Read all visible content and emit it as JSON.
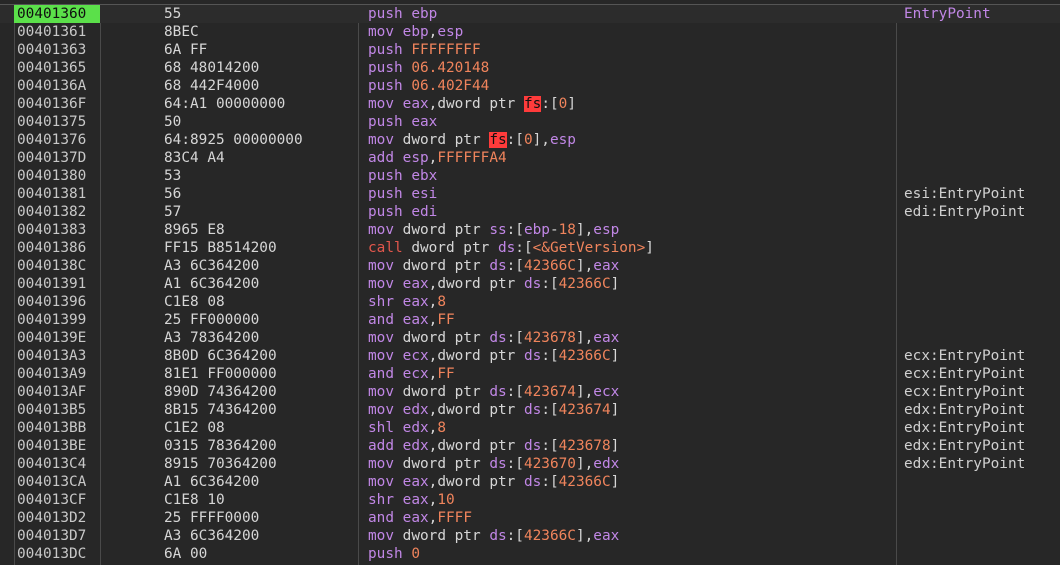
{
  "rows": [
    {
      "addr": "00401360",
      "bytes": "55",
      "selected": true,
      "comment": "EntryPoint",
      "comment_style": "entry",
      "instr": [
        [
          "mn",
          "push"
        ],
        [
          "txt",
          " "
        ],
        [
          "reg",
          "ebp"
        ]
      ]
    },
    {
      "addr": "00401361",
      "bytes": "8BEC",
      "comment": "",
      "instr": [
        [
          "mn",
          "mov"
        ],
        [
          "txt",
          " "
        ],
        [
          "reg",
          "ebp"
        ],
        [
          "txt",
          ","
        ],
        [
          "reg",
          "esp"
        ]
      ]
    },
    {
      "addr": "00401363",
      "bytes": "6A FF",
      "comment": "",
      "instr": [
        [
          "mn",
          "push"
        ],
        [
          "txt",
          " "
        ],
        [
          "num",
          "FFFFFFFF"
        ]
      ]
    },
    {
      "addr": "00401365",
      "bytes": "68 48014200",
      "comment": "",
      "instr": [
        [
          "mn",
          "push"
        ],
        [
          "txt",
          " "
        ],
        [
          "num",
          "06.420148"
        ]
      ]
    },
    {
      "addr": "0040136A",
      "bytes": "68 442F4000",
      "comment": "",
      "instr": [
        [
          "mn",
          "push"
        ],
        [
          "txt",
          " "
        ],
        [
          "num",
          "06.402F44"
        ]
      ]
    },
    {
      "addr": "0040136F",
      "bytes": "64:A1 00000000",
      "comment": "",
      "instr": [
        [
          "mn",
          "mov"
        ],
        [
          "txt",
          " "
        ],
        [
          "reg",
          "eax"
        ],
        [
          "txt",
          ",dword ptr "
        ],
        [
          "hl",
          "fs"
        ],
        [
          "txt",
          ":["
        ],
        [
          "num",
          "0"
        ],
        [
          "txt",
          "]"
        ]
      ]
    },
    {
      "addr": "00401375",
      "bytes": "50",
      "comment": "",
      "instr": [
        [
          "mn",
          "push"
        ],
        [
          "txt",
          " "
        ],
        [
          "reg",
          "eax"
        ]
      ]
    },
    {
      "addr": "00401376",
      "bytes": "64:8925 00000000",
      "comment": "",
      "instr": [
        [
          "mn",
          "mov"
        ],
        [
          "txt",
          " dword ptr "
        ],
        [
          "hl",
          "fs"
        ],
        [
          "txt",
          ":["
        ],
        [
          "num",
          "0"
        ],
        [
          "txt",
          "],"
        ],
        [
          "reg",
          "esp"
        ]
      ]
    },
    {
      "addr": "0040137D",
      "bytes": "83C4 A4",
      "comment": "",
      "instr": [
        [
          "mn",
          "add"
        ],
        [
          "txt",
          " "
        ],
        [
          "reg",
          "esp"
        ],
        [
          "txt",
          ","
        ],
        [
          "num",
          "FFFFFFA4"
        ]
      ]
    },
    {
      "addr": "00401380",
      "bytes": "53",
      "comment": "",
      "instr": [
        [
          "mn",
          "push"
        ],
        [
          "txt",
          " "
        ],
        [
          "reg",
          "ebx"
        ]
      ]
    },
    {
      "addr": "00401381",
      "bytes": "56",
      "comment": "esi:EntryPoint",
      "instr": [
        [
          "mn",
          "push"
        ],
        [
          "txt",
          " "
        ],
        [
          "reg",
          "esi"
        ]
      ]
    },
    {
      "addr": "00401382",
      "bytes": "57",
      "comment": "edi:EntryPoint",
      "instr": [
        [
          "mn",
          "push"
        ],
        [
          "txt",
          " "
        ],
        [
          "reg",
          "edi"
        ]
      ]
    },
    {
      "addr": "00401383",
      "bytes": "8965 E8",
      "comment": "",
      "instr": [
        [
          "mn",
          "mov"
        ],
        [
          "txt",
          " dword ptr "
        ],
        [
          "seg",
          "ss"
        ],
        [
          "txt",
          ":["
        ],
        [
          "reg",
          "ebp"
        ],
        [
          "txt",
          "-"
        ],
        [
          "num",
          "18"
        ],
        [
          "txt",
          "],"
        ],
        [
          "reg",
          "esp"
        ]
      ]
    },
    {
      "addr": "00401386",
      "bytes": "FF15 B8514200",
      "comment": "",
      "instr": [
        [
          "call",
          "call"
        ],
        [
          "txt",
          " dword ptr "
        ],
        [
          "seg",
          "ds"
        ],
        [
          "txt",
          ":["
        ],
        [
          "sym",
          "<&GetVersion>"
        ],
        [
          "txt",
          "]"
        ]
      ]
    },
    {
      "addr": "0040138C",
      "bytes": "A3 6C364200",
      "comment": "",
      "instr": [
        [
          "mn",
          "mov"
        ],
        [
          "txt",
          " dword ptr "
        ],
        [
          "seg",
          "ds"
        ],
        [
          "txt",
          ":["
        ],
        [
          "num",
          "42366C"
        ],
        [
          "txt",
          "],"
        ],
        [
          "reg",
          "eax"
        ]
      ]
    },
    {
      "addr": "00401391",
      "bytes": "A1 6C364200",
      "comment": "",
      "instr": [
        [
          "mn",
          "mov"
        ],
        [
          "txt",
          " "
        ],
        [
          "reg",
          "eax"
        ],
        [
          "txt",
          ",dword ptr "
        ],
        [
          "seg",
          "ds"
        ],
        [
          "txt",
          ":["
        ],
        [
          "num",
          "42366C"
        ],
        [
          "txt",
          "]"
        ]
      ]
    },
    {
      "addr": "00401396",
      "bytes": "C1E8 08",
      "comment": "",
      "instr": [
        [
          "mn",
          "shr"
        ],
        [
          "txt",
          " "
        ],
        [
          "reg",
          "eax"
        ],
        [
          "txt",
          ","
        ],
        [
          "num",
          "8"
        ]
      ]
    },
    {
      "addr": "00401399",
      "bytes": "25 FF000000",
      "comment": "",
      "instr": [
        [
          "mn",
          "and"
        ],
        [
          "txt",
          " "
        ],
        [
          "reg",
          "eax"
        ],
        [
          "txt",
          ","
        ],
        [
          "num",
          "FF"
        ]
      ]
    },
    {
      "addr": "0040139E",
      "bytes": "A3 78364200",
      "comment": "",
      "instr": [
        [
          "mn",
          "mov"
        ],
        [
          "txt",
          " dword ptr "
        ],
        [
          "seg",
          "ds"
        ],
        [
          "txt",
          ":["
        ],
        [
          "num",
          "423678"
        ],
        [
          "txt",
          "],"
        ],
        [
          "reg",
          "eax"
        ]
      ]
    },
    {
      "addr": "004013A3",
      "bytes": "8B0D 6C364200",
      "comment": "ecx:EntryPoint",
      "instr": [
        [
          "mn",
          "mov"
        ],
        [
          "txt",
          " "
        ],
        [
          "reg",
          "ecx"
        ],
        [
          "txt",
          ",dword ptr "
        ],
        [
          "seg",
          "ds"
        ],
        [
          "txt",
          ":["
        ],
        [
          "num",
          "42366C"
        ],
        [
          "txt",
          "]"
        ]
      ]
    },
    {
      "addr": "004013A9",
      "bytes": "81E1 FF000000",
      "comment": "ecx:EntryPoint",
      "instr": [
        [
          "mn",
          "and"
        ],
        [
          "txt",
          " "
        ],
        [
          "reg",
          "ecx"
        ],
        [
          "txt",
          ","
        ],
        [
          "num",
          "FF"
        ]
      ]
    },
    {
      "addr": "004013AF",
      "bytes": "890D 74364200",
      "comment": "ecx:EntryPoint",
      "instr": [
        [
          "mn",
          "mov"
        ],
        [
          "txt",
          " dword ptr "
        ],
        [
          "seg",
          "ds"
        ],
        [
          "txt",
          ":["
        ],
        [
          "num",
          "423674"
        ],
        [
          "txt",
          "],"
        ],
        [
          "reg",
          "ecx"
        ]
      ]
    },
    {
      "addr": "004013B5",
      "bytes": "8B15 74364200",
      "comment": "edx:EntryPoint",
      "instr": [
        [
          "mn",
          "mov"
        ],
        [
          "txt",
          " "
        ],
        [
          "reg",
          "edx"
        ],
        [
          "txt",
          ",dword ptr "
        ],
        [
          "seg",
          "ds"
        ],
        [
          "txt",
          ":["
        ],
        [
          "num",
          "423674"
        ],
        [
          "txt",
          "]"
        ]
      ]
    },
    {
      "addr": "004013BB",
      "bytes": "C1E2 08",
      "comment": "edx:EntryPoint",
      "instr": [
        [
          "mn",
          "shl"
        ],
        [
          "txt",
          " "
        ],
        [
          "reg",
          "edx"
        ],
        [
          "txt",
          ","
        ],
        [
          "num",
          "8"
        ]
      ]
    },
    {
      "addr": "004013BE",
      "bytes": "0315 78364200",
      "comment": "edx:EntryPoint",
      "instr": [
        [
          "mn",
          "add"
        ],
        [
          "txt",
          " "
        ],
        [
          "reg",
          "edx"
        ],
        [
          "txt",
          ",dword ptr "
        ],
        [
          "seg",
          "ds"
        ],
        [
          "txt",
          ":["
        ],
        [
          "num",
          "423678"
        ],
        [
          "txt",
          "]"
        ]
      ]
    },
    {
      "addr": "004013C4",
      "bytes": "8915 70364200",
      "comment": "edx:EntryPoint",
      "instr": [
        [
          "mn",
          "mov"
        ],
        [
          "txt",
          " dword ptr "
        ],
        [
          "seg",
          "ds"
        ],
        [
          "txt",
          ":["
        ],
        [
          "num",
          "423670"
        ],
        [
          "txt",
          "],"
        ],
        [
          "reg",
          "edx"
        ]
      ]
    },
    {
      "addr": "004013CA",
      "bytes": "A1 6C364200",
      "comment": "",
      "instr": [
        [
          "mn",
          "mov"
        ],
        [
          "txt",
          " "
        ],
        [
          "reg",
          "eax"
        ],
        [
          "txt",
          ",dword ptr "
        ],
        [
          "seg",
          "ds"
        ],
        [
          "txt",
          ":["
        ],
        [
          "num",
          "42366C"
        ],
        [
          "txt",
          "]"
        ]
      ]
    },
    {
      "addr": "004013CF",
      "bytes": "C1E8 10",
      "comment": "",
      "instr": [
        [
          "mn",
          "shr"
        ],
        [
          "txt",
          " "
        ],
        [
          "reg",
          "eax"
        ],
        [
          "txt",
          ","
        ],
        [
          "num",
          "10"
        ]
      ]
    },
    {
      "addr": "004013D2",
      "bytes": "25 FFFF0000",
      "comment": "",
      "instr": [
        [
          "mn",
          "and"
        ],
        [
          "txt",
          " "
        ],
        [
          "reg",
          "eax"
        ],
        [
          "txt",
          ","
        ],
        [
          "num",
          "FFFF"
        ]
      ]
    },
    {
      "addr": "004013D7",
      "bytes": "A3 6C364200",
      "comment": "",
      "instr": [
        [
          "mn",
          "mov"
        ],
        [
          "txt",
          " dword ptr "
        ],
        [
          "seg",
          "ds"
        ],
        [
          "txt",
          ":["
        ],
        [
          "num",
          "42366C"
        ],
        [
          "txt",
          "],"
        ],
        [
          "reg",
          "eax"
        ]
      ]
    },
    {
      "addr": "004013DC",
      "bytes": "6A 00",
      "comment": "",
      "instr": [
        [
          "mn",
          "push"
        ],
        [
          "txt",
          " "
        ],
        [
          "num",
          "0"
        ]
      ]
    }
  ],
  "colors": {
    "background": "#272727",
    "selected_address": "#5be04a",
    "mnemonic": "#c187e6",
    "call": "#e2574c",
    "immediate": "#f0845c",
    "segment_highlight": "#ff3b3b"
  }
}
